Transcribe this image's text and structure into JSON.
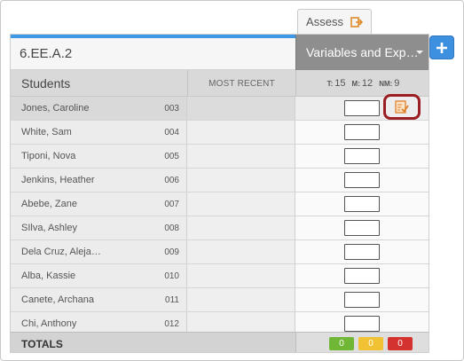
{
  "tab": {
    "label": "Assess",
    "icon": "export-arrow-icon"
  },
  "add_button": {
    "icon": "plus-icon"
  },
  "standard": "6.EE.A.2",
  "assessment": {
    "title": "Variables and Exp…"
  },
  "columns": {
    "students": "Students",
    "most_recent": "MOST RECENT",
    "counts": {
      "t_label": "T:",
      "t_value": "15",
      "m_label": "M:",
      "m_value": "12",
      "nm_label": "NM:",
      "nm_value": "9"
    }
  },
  "students": [
    {
      "name": "Jones, Caroline",
      "id": "003",
      "selected": true
    },
    {
      "name": "White, Sam",
      "id": "004"
    },
    {
      "name": "Tiponi, Nova",
      "id": "005"
    },
    {
      "name": "Jenkins, Heather",
      "id": "006"
    },
    {
      "name": "Abebe, Zane",
      "id": "007"
    },
    {
      "name": "SIlva, Ashley",
      "id": "008"
    },
    {
      "name": "Dela Cruz, Aleja…",
      "id": "009"
    },
    {
      "name": "Alba, Kassie",
      "id": "010"
    },
    {
      "name": "Canete, Archana",
      "id": "011"
    },
    {
      "name": "Chi, Anthony",
      "id": "012"
    }
  ],
  "totals": {
    "label": "TOTALS",
    "green": "0",
    "yellow": "0",
    "red": "0"
  },
  "colors": {
    "accent_blue": "#3f98e6",
    "button_blue": "#3d8fe0",
    "highlight_red": "#9b1f22",
    "green": "#6fb734",
    "yellow": "#f1c234",
    "red": "#d3322f"
  }
}
